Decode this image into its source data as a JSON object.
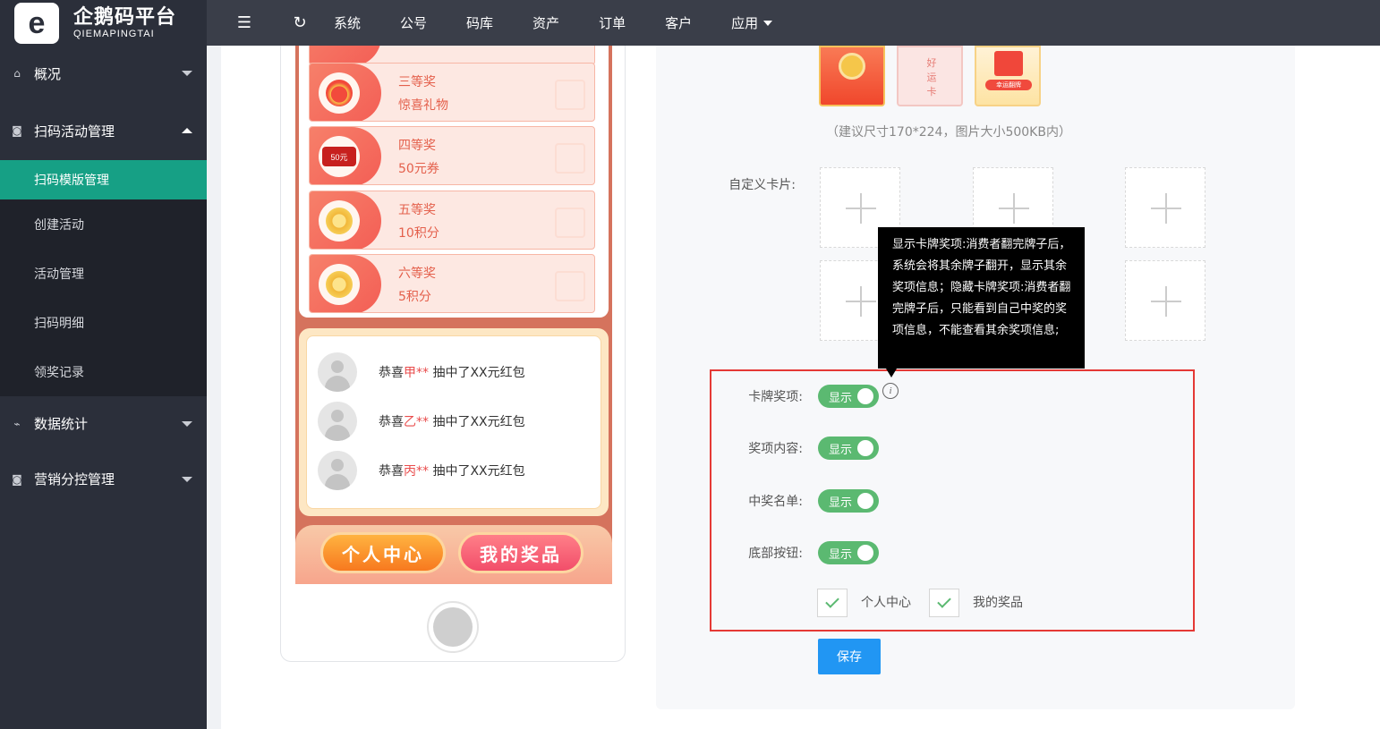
{
  "brand": {
    "name_cn": "企鹅码平台",
    "name_en": "QIEMAPINGTAI",
    "logo_letter": "e"
  },
  "sidebar": {
    "groups": [
      {
        "label": "概况",
        "icon": "home-icon",
        "expanded": false
      },
      {
        "label": "扫码活动管理",
        "icon": "camera-icon",
        "expanded": true,
        "items": [
          "扫码模版管理",
          "创建活动",
          "活动管理",
          "扫码明细",
          "领奖记录"
        ],
        "active": "扫码模版管理"
      },
      {
        "label": "数据统计",
        "icon": "pulse-icon",
        "expanded": false
      },
      {
        "label": "营销分控管理",
        "icon": "camera-icon",
        "expanded": false
      }
    ]
  },
  "topbar": {
    "menu": [
      "系统",
      "公号",
      "码库",
      "资产",
      "订单",
      "客户",
      "应用"
    ]
  },
  "preview": {
    "prizes": [
      {
        "level": "三等奖",
        "desc": "惊喜礼物",
        "icon": "gift-icon"
      },
      {
        "level": "四等奖",
        "desc": "50元券",
        "icon": "coupon-icon",
        "coupon_text": "50元"
      },
      {
        "level": "五等奖",
        "desc": "10积分",
        "icon": "coin-icon"
      },
      {
        "level": "六等奖",
        "desc": "5积分",
        "icon": "coin-icon"
      }
    ],
    "winners": [
      {
        "prefix": "恭喜",
        "name": "甲**",
        "suffix": " 抽中了XX元红包"
      },
      {
        "prefix": "恭喜",
        "name": "乙**",
        "suffix": " 抽中了XX元红包"
      },
      {
        "prefix": "恭喜",
        "name": "丙**",
        "suffix": " 抽中了XX元红包"
      }
    ],
    "buttons": {
      "left": "个人中心",
      "right": "我的奖品"
    }
  },
  "settings": {
    "card_thumbs": {
      "t2_text": "好运卡",
      "t3_text": "幸运翻牌"
    },
    "hint": "（建议尺寸170*224，图片大小500KB内）",
    "custom_cards_label": "自定义卡片:",
    "rows": [
      {
        "label": "卡牌奖项:",
        "switch_text": "显示",
        "on": true
      },
      {
        "label": "奖项内容:",
        "switch_text": "显示",
        "on": true
      },
      {
        "label": "中奖名单:",
        "switch_text": "显示",
        "on": true
      },
      {
        "label": "底部按钮:",
        "switch_text": "显示",
        "on": true
      }
    ],
    "checkboxes": [
      {
        "label": "个人中心",
        "checked": true
      },
      {
        "label": "我的奖品",
        "checked": true
      }
    ],
    "save_label": "保存",
    "tooltip": "显示卡牌奖项:消费者翻完牌子后，系统会将其余牌子翻开，显示其余奖项信息；隐藏卡牌奖项:消费者翻完牌子后，只能看到自己中奖的奖项信息，不能查看其余奖项信息;",
    "info_icon_glyph": "i"
  }
}
